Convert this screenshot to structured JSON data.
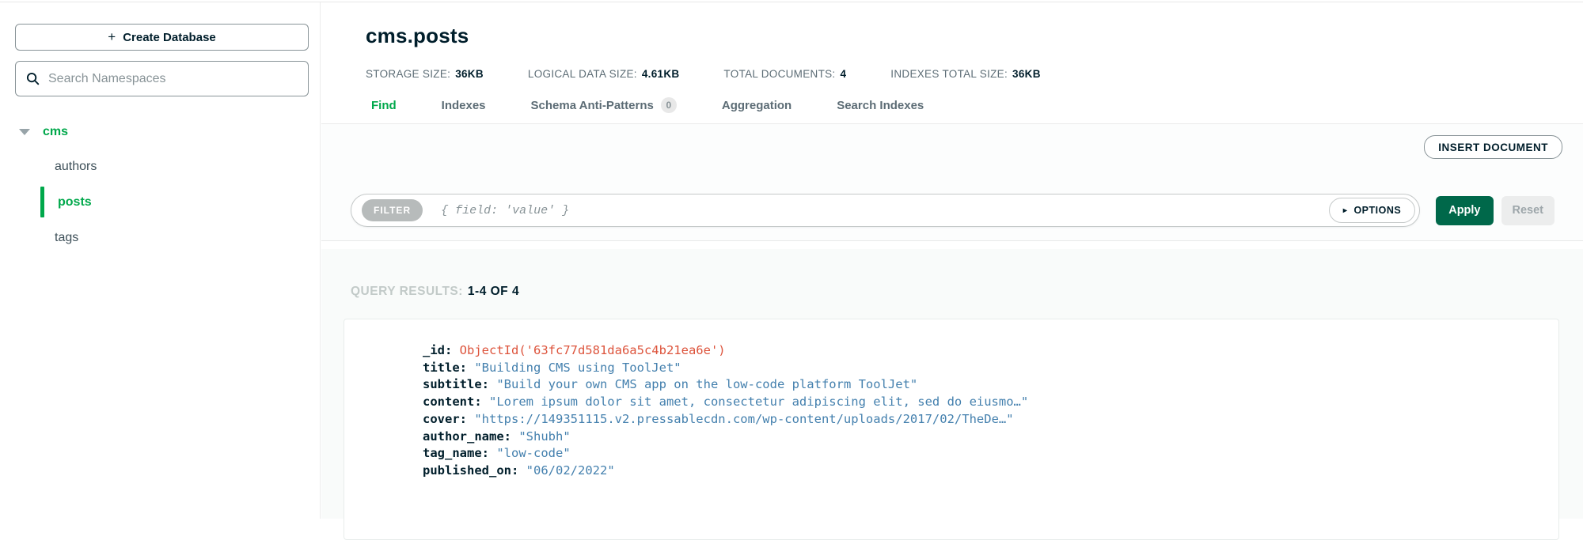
{
  "colors": {
    "green": "#00A84B",
    "apply_green": "#00684A",
    "dark_navy": "#001E2B",
    "string_blue": "#4480AE",
    "objectid_red": "#DD543C"
  },
  "icons": {
    "plus": "+",
    "caret_right": "▸"
  },
  "sidebar": {
    "create_database_label": "Create Database",
    "search_placeholder": "Search Namespaces",
    "database": {
      "label": "cms"
    },
    "collections": [
      {
        "label": "authors",
        "active": false
      },
      {
        "label": "posts",
        "active": true
      },
      {
        "label": "tags",
        "active": false
      }
    ]
  },
  "header": {
    "title": "cms.posts",
    "stats": [
      {
        "label": "STORAGE SIZE:",
        "value": "36KB"
      },
      {
        "label": "LOGICAL DATA SIZE:",
        "value": "4.61KB"
      },
      {
        "label": "TOTAL DOCUMENTS:",
        "value": "4"
      },
      {
        "label": "INDEXES TOTAL SIZE:",
        "value": "36KB"
      }
    ],
    "tabs": [
      {
        "label": "Find",
        "active": true
      },
      {
        "label": "Indexes",
        "active": false
      },
      {
        "label": "Schema Anti-Patterns",
        "active": false,
        "badge": "0"
      },
      {
        "label": "Aggregation",
        "active": false
      },
      {
        "label": "Search Indexes",
        "active": false
      }
    ]
  },
  "toolbar": {
    "insert_document_label": "INSERT DOCUMENT",
    "filter_badge": "FILTER",
    "filter_placeholder": "{ field: 'value' }",
    "options_label": "OPTIONS",
    "apply_label": "Apply",
    "reset_label": "Reset"
  },
  "results": {
    "label": "QUERY RESULTS:",
    "count": "1-4 OF 4",
    "document": {
      "fields": [
        {
          "key": "_id",
          "value": "ObjectId('63fc77d581da6a5c4b21ea6e')",
          "type": "objectid"
        },
        {
          "key": "title",
          "value": "\"Building CMS using ToolJet\"",
          "type": "string"
        },
        {
          "key": "subtitle",
          "value": "\"Build your own CMS app on the low-code platform ToolJet\"",
          "type": "string"
        },
        {
          "key": "content",
          "value": "\"Lorem ipsum dolor sit amet, consectetur adipiscing elit, sed do eiusmo…\"",
          "type": "string"
        },
        {
          "key": "cover",
          "value": "\"https://149351115.v2.pressablecdn.com/wp-content/uploads/2017/02/TheDe…\"",
          "type": "string"
        },
        {
          "key": "author_name",
          "value": "\"Shubh\"",
          "type": "string"
        },
        {
          "key": "tag_name",
          "value": "\"low-code\"",
          "type": "string"
        },
        {
          "key": "published_on",
          "value": "\"06/02/2022\"",
          "type": "string"
        }
      ]
    }
  }
}
